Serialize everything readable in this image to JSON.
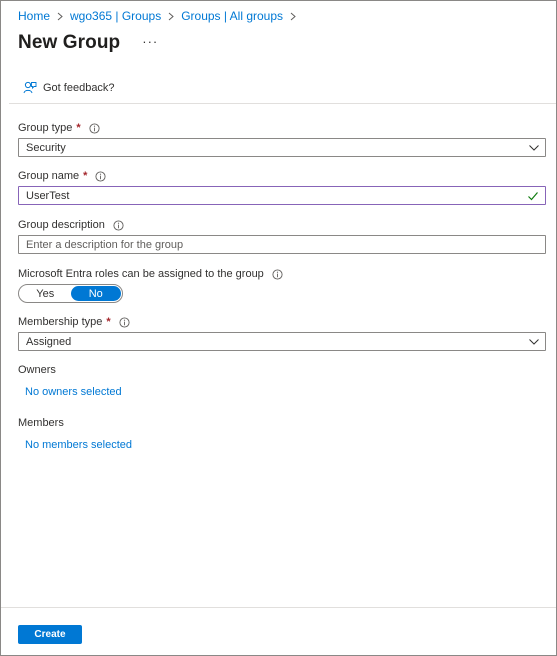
{
  "breadcrumb": [
    "Home",
    "wgo365 | Groups",
    "Groups | All groups"
  ],
  "page": {
    "title": "New Group",
    "more_label": "···"
  },
  "toolbar": {
    "feedback_label": "Got feedback?"
  },
  "form": {
    "group_type": {
      "label": "Group type",
      "required_mark": "*",
      "value": "Security"
    },
    "group_name": {
      "label": "Group name",
      "required_mark": "*",
      "value": "UserTest"
    },
    "group_description": {
      "label": "Group description",
      "placeholder": "Enter a description for the group"
    },
    "entra_roles": {
      "label": "Microsoft Entra roles can be assigned to the group",
      "yes_label": "Yes",
      "no_label": "No",
      "selected": "No"
    },
    "membership_type": {
      "label": "Membership type",
      "required_mark": "*",
      "value": "Assigned"
    },
    "owners": {
      "label": "Owners",
      "link": "No owners selected"
    },
    "members": {
      "label": "Members",
      "link": "No members selected"
    }
  },
  "footer": {
    "create_label": "Create"
  },
  "colors": {
    "accent": "#0078d4",
    "required": "#a4262c",
    "active_border": "#8764b8",
    "valid_check": "#107c10"
  },
  "icons": [
    "chevron-right-icon",
    "more-icon",
    "feedback-icon",
    "info-icon",
    "chevron-down-icon",
    "checkmark-icon"
  ]
}
